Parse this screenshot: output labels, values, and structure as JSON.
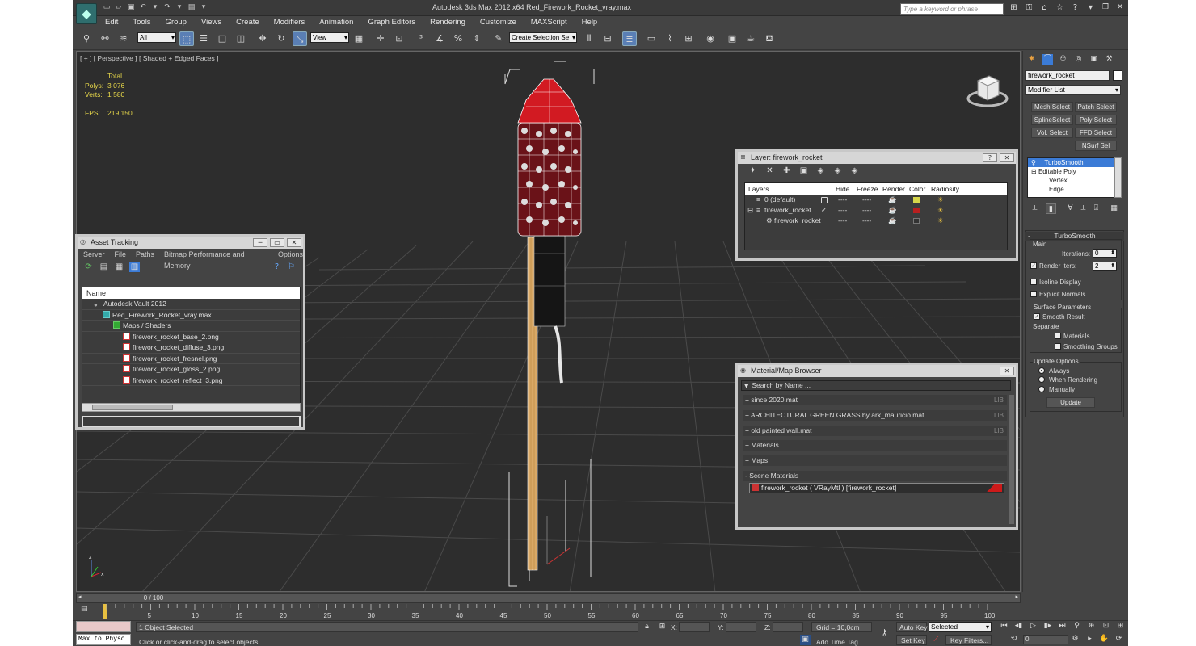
{
  "window": {
    "title": "Autodesk 3ds Max  2012 x64     Red_Firework_Rocket_vray.max",
    "search_placeholder": "Type a keyword or phrase",
    "logo": "3ds-max-logo"
  },
  "menu": [
    "Edit",
    "Tools",
    "Group",
    "Views",
    "Create",
    "Modifiers",
    "Animation",
    "Graph Editors",
    "Rendering",
    "Customize",
    "MAXScript",
    "Help"
  ],
  "toolbar": {
    "selection_filter": "All",
    "reference_coord": "View",
    "named_selection_placeholder": "Create Selection Se"
  },
  "viewport": {
    "label": "[ + ] [ Perspective ] [ Shaded + Edged Faces ]",
    "stats": {
      "header": "Total",
      "polys_label": "Polys:",
      "polys_value": "3 076",
      "verts_label": "Verts:",
      "verts_value": "1 580",
      "fps_label": "FPS:",
      "fps_value": "219,150"
    }
  },
  "asset_tracking": {
    "title": "Asset Tracking",
    "menu": [
      "Server",
      "File",
      "Paths",
      "Bitmap Performance and Memory",
      "Options"
    ],
    "column": "Name",
    "rows": [
      {
        "label": "Autodesk Vault 2012",
        "icon": "vault-icon"
      },
      {
        "label": "Red_Firework_Rocket_vray.max",
        "icon": "max-file-icon"
      },
      {
        "label": "Maps / Shaders",
        "icon": "maps-icon"
      },
      {
        "label": "firework_rocket_base_2.png",
        "icon": "image-file-icon"
      },
      {
        "label": "firework_rocket_diffuse_3.png",
        "icon": "image-file-icon"
      },
      {
        "label": "firework_rocket_fresnel.png",
        "icon": "image-file-icon"
      },
      {
        "label": "firework_rocket_gloss_2.png",
        "icon": "image-file-icon"
      },
      {
        "label": "firework_rocket_reflect_3.png",
        "icon": "image-file-icon"
      }
    ]
  },
  "layer_dialog": {
    "title": "Layer: firework_rocket",
    "columns": {
      "layers": "Layers",
      "hide": "Hide",
      "freeze": "Freeze",
      "render": "Render",
      "color": "Color",
      "radiosity": "Radiosity"
    },
    "rows": [
      {
        "name": "0 (default)",
        "hide": "----",
        "freeze": "----",
        "color": "#d6d64a"
      },
      {
        "name": "firework_rocket",
        "hide": "----",
        "freeze": "----",
        "color": "#b82020"
      },
      {
        "name": "firework_rocket",
        "hide": "----",
        "freeze": "----",
        "color": "#333333"
      }
    ]
  },
  "material_browser": {
    "title": "Material/Map Browser",
    "search_placeholder": "Search by Name ...",
    "lib_tag": "LIB",
    "groups": [
      "+ since 2020.mat",
      "+ ARCHITECTURAL GREEN GRASS by ark_mauricio.mat",
      "+ old painted wall.mat",
      "+ Materials",
      "+ Maps",
      "- Scene Materials"
    ],
    "scene_material": "firework_rocket  ( VRayMtl )  [firework_rocket]",
    "material_color": "#cc1a1a"
  },
  "command_panel": {
    "object_name": "firework_rocket",
    "modifier_list": "Modifier List",
    "buttons": [
      "Mesh Select",
      "Patch Select",
      "SplineSelect",
      "Poly Select",
      "Vol. Select",
      "FFD Select",
      "NSurf Sel"
    ],
    "stack": [
      "TurboSmooth",
      "Editable Poly",
      "Vertex",
      "Edge"
    ],
    "turbosmooth": {
      "title": "TurboSmooth",
      "main_label": "Main",
      "iterations_label": "Iterations:",
      "iterations_value": "0",
      "render_iters_label": "Render Iters:",
      "render_iters_value": "2",
      "isoline_label": "Isoline Display",
      "explicit_label": "Explicit Normals",
      "surface_label": "Surface Parameters",
      "smooth_label": "Smooth Result",
      "separate_label": "Separate",
      "materials_label": "Materials",
      "smoothing_label": "Smoothing Groups",
      "update_label": "Update Options",
      "always_label": "Always",
      "when_rendering_label": "When Rendering",
      "manually_label": "Manually",
      "update_button": "Update"
    }
  },
  "timeline": {
    "frame": "0 / 100",
    "ticks": [
      "0",
      "5",
      "10",
      "15",
      "20",
      "25",
      "30",
      "35",
      "40",
      "45",
      "50",
      "55",
      "60",
      "65",
      "70",
      "75",
      "80",
      "85",
      "90",
      "95",
      "100"
    ]
  },
  "status": {
    "maxscript": "Max to Physc",
    "selected": "1 Object Selected",
    "prompt": "Click or click-and-drag to select objects",
    "x_label": "X:",
    "y_label": "Y:",
    "z_label": "Z:",
    "grid": "Grid = 10,0cm",
    "add_time_tag": "Add Time Tag",
    "auto_key": "Auto Key",
    "set_key": "Set Key",
    "selected_dropdown": "Selected",
    "key_filters": "Key Filters...",
    "frame_value": "0"
  }
}
